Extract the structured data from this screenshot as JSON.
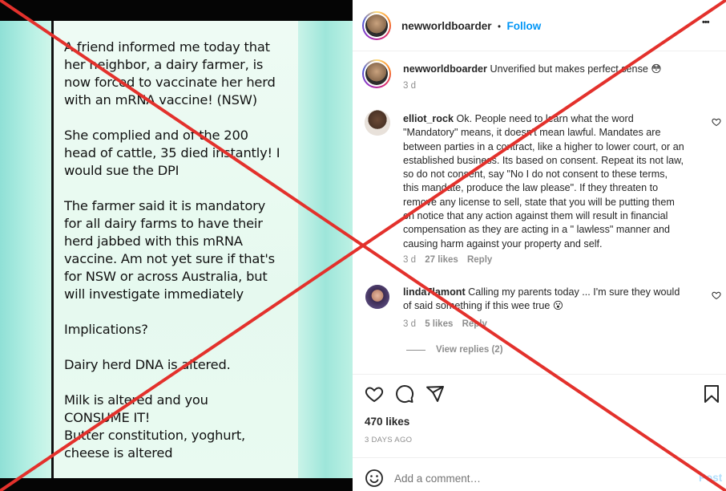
{
  "post_image": {
    "paragraphs": [
      [
        "A friend informed me today that",
        "her neighbor, a dairy farmer, is",
        "now forced to vaccinate her herd",
        "with an mRNA vaccine! (NSW)"
      ],
      [
        "She complied and of the 200",
        "head of cattle, 35 died instantly! I",
        "would sue the DPI"
      ],
      [
        "The farmer said it is mandatory",
        "for all dairy farms to have their",
        "herd jabbed with this mRNA",
        "vaccine. Am not yet sure if that's",
        "for NSW or across Australia, but",
        "will investigate immediately"
      ],
      [
        "Implications?"
      ],
      [
        "Dairy herd DNA is altered."
      ],
      [
        "Milk is altered and you",
        "CONSUME IT!",
        "Butter constitution, yoghurt,",
        "cheese is altered"
      ]
    ]
  },
  "header": {
    "username": "newworldboarder",
    "separator": "•",
    "follow_label": "Follow",
    "more_label": "•••"
  },
  "caption": {
    "username": "newworldboarder",
    "text": "Unverified but makes perfect sense",
    "emoji": "😳",
    "time": "3 d"
  },
  "comments": [
    {
      "username": "elliot_rock",
      "lines": [
        "Ok. People need to learn what the word",
        "\"Mandatory\" means, it doesn't mean lawful. Mandates are",
        "between parties in a contract, like a higher to lower court, or an",
        "established business. Its based on consent. Repeat its not law,",
        "so do not consent, say \"No I do not consent to these terms,",
        "this mandate, produce the law please\". If they threaten to",
        "remove any license to sell, state that you will be putting them",
        "on notice that any action against them will result in financial",
        "compensation as they are acting in a \" lawless\" manner and",
        "causing harm against your property and self."
      ],
      "time": "3 d",
      "likes": "27 likes",
      "reply": "Reply"
    },
    {
      "username": "linda7lamont",
      "lines": [
        "Calling my parents today ... I'm sure they would",
        "of said something if this wee true"
      ],
      "emoji": "😮",
      "time": "3 d",
      "likes": "5 likes",
      "reply": "Reply",
      "view_replies": "View replies (2)"
    }
  ],
  "actions": {
    "likes": "470 likes",
    "date": "3 DAYS AGO"
  },
  "add_comment": {
    "placeholder": "Add a comment…",
    "post_label": "Post"
  },
  "colors": {
    "accent": "#0095f6",
    "overlay_x": "#e3312c",
    "muted": "#8e8e8e"
  }
}
